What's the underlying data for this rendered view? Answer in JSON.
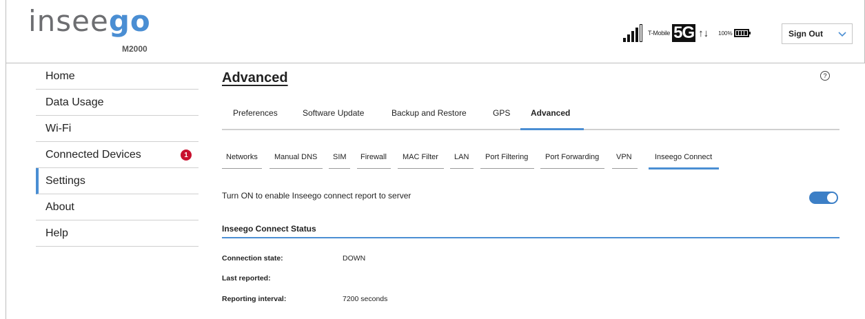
{
  "header": {
    "logo_main": "insee",
    "logo_accent": "go",
    "model": "M2000",
    "carrier": "T-Mobile",
    "network": "5G",
    "arrows": "↑↓",
    "battery_pct": "100%",
    "signout_label": "Sign Out"
  },
  "sidebar": {
    "items": [
      {
        "label": "Home"
      },
      {
        "label": "Data Usage"
      },
      {
        "label": "Wi-Fi"
      },
      {
        "label": "Connected Devices",
        "badge": "1"
      },
      {
        "label": "Settings",
        "active": true
      },
      {
        "label": "About"
      },
      {
        "label": "Help"
      }
    ]
  },
  "main": {
    "title": "Advanced",
    "help_glyph": "?",
    "tabs": [
      {
        "label": "Preferences"
      },
      {
        "label": "Software Update"
      },
      {
        "label": "Backup and Restore"
      },
      {
        "label": "GPS"
      },
      {
        "label": "Advanced",
        "active": true
      }
    ],
    "subtabs": [
      {
        "label": "Networks"
      },
      {
        "label": "Manual DNS"
      },
      {
        "label": "SIM"
      },
      {
        "label": "Firewall"
      },
      {
        "label": "MAC Filter"
      },
      {
        "label": "LAN"
      },
      {
        "label": "Port Filtering"
      },
      {
        "label": "Port Forwarding"
      },
      {
        "label": "VPN"
      },
      {
        "label": "Inseego Connect",
        "active": true
      }
    ],
    "toggle_label": "Turn ON to enable Inseego connect report to server",
    "toggle_on": true,
    "section_title": "Inseego Connect Status",
    "status_rows": [
      {
        "label": "Connection state:",
        "value": "DOWN"
      },
      {
        "label": "Last reported:",
        "value": ""
      },
      {
        "label": "Reporting interval:",
        "value": "7200 seconds"
      }
    ]
  },
  "colors": {
    "accent": "#4a8ed3",
    "badge": "#c8102e",
    "toggle": "#3c7fc6"
  }
}
